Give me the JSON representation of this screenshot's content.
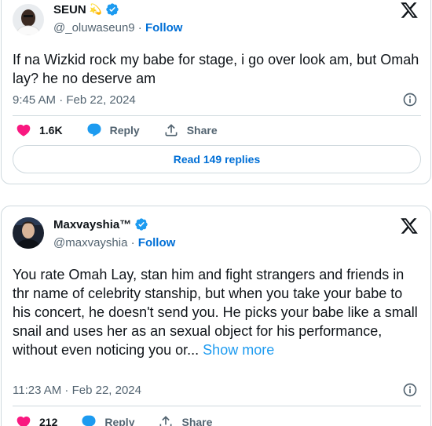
{
  "tweets": [
    {
      "display_name": "SEUN",
      "name_emoji": "💫",
      "handle": "@_oluwaseun9",
      "separator": " · ",
      "follow_label": "Follow",
      "text": "If na Wizkid rock my babe for stage, i go over look am, but Omah lay? he no deserve am",
      "timestamp": "9:45 AM · Feb 22, 2024",
      "like_count": "1.6K",
      "reply_label": "Reply",
      "share_label": "Share",
      "read_replies_label": "Read 149 replies"
    },
    {
      "display_name": "Maxvayshia™",
      "handle": "@maxvayshia",
      "separator": " · ",
      "follow_label": "Follow",
      "text": "You rate Omah Lay, stan him and fight strangers and friends in thr name of celebrity stanship, but when you take your babe to his concert, he doesn't send you. He picks your babe like a small snail and uses her as an sexual object for his performance, without even noticing you or...",
      "show_more_label": "Show more",
      "timestamp": "11:23 AM · Feb 22, 2024",
      "like_count": "212",
      "reply_label": "Reply",
      "share_label": "Share"
    }
  ],
  "icons": {
    "verified": "verified-badge-icon",
    "x_logo": "x-logo-icon",
    "info": "info-icon",
    "like": "heart-icon",
    "reply": "reply-bubble-icon",
    "share": "share-upload-icon"
  },
  "colors": {
    "accent": "#1d9bf0",
    "follow": "#006fd6",
    "like": "#f91880",
    "muted": "#536471",
    "border": "#cfd9de"
  }
}
